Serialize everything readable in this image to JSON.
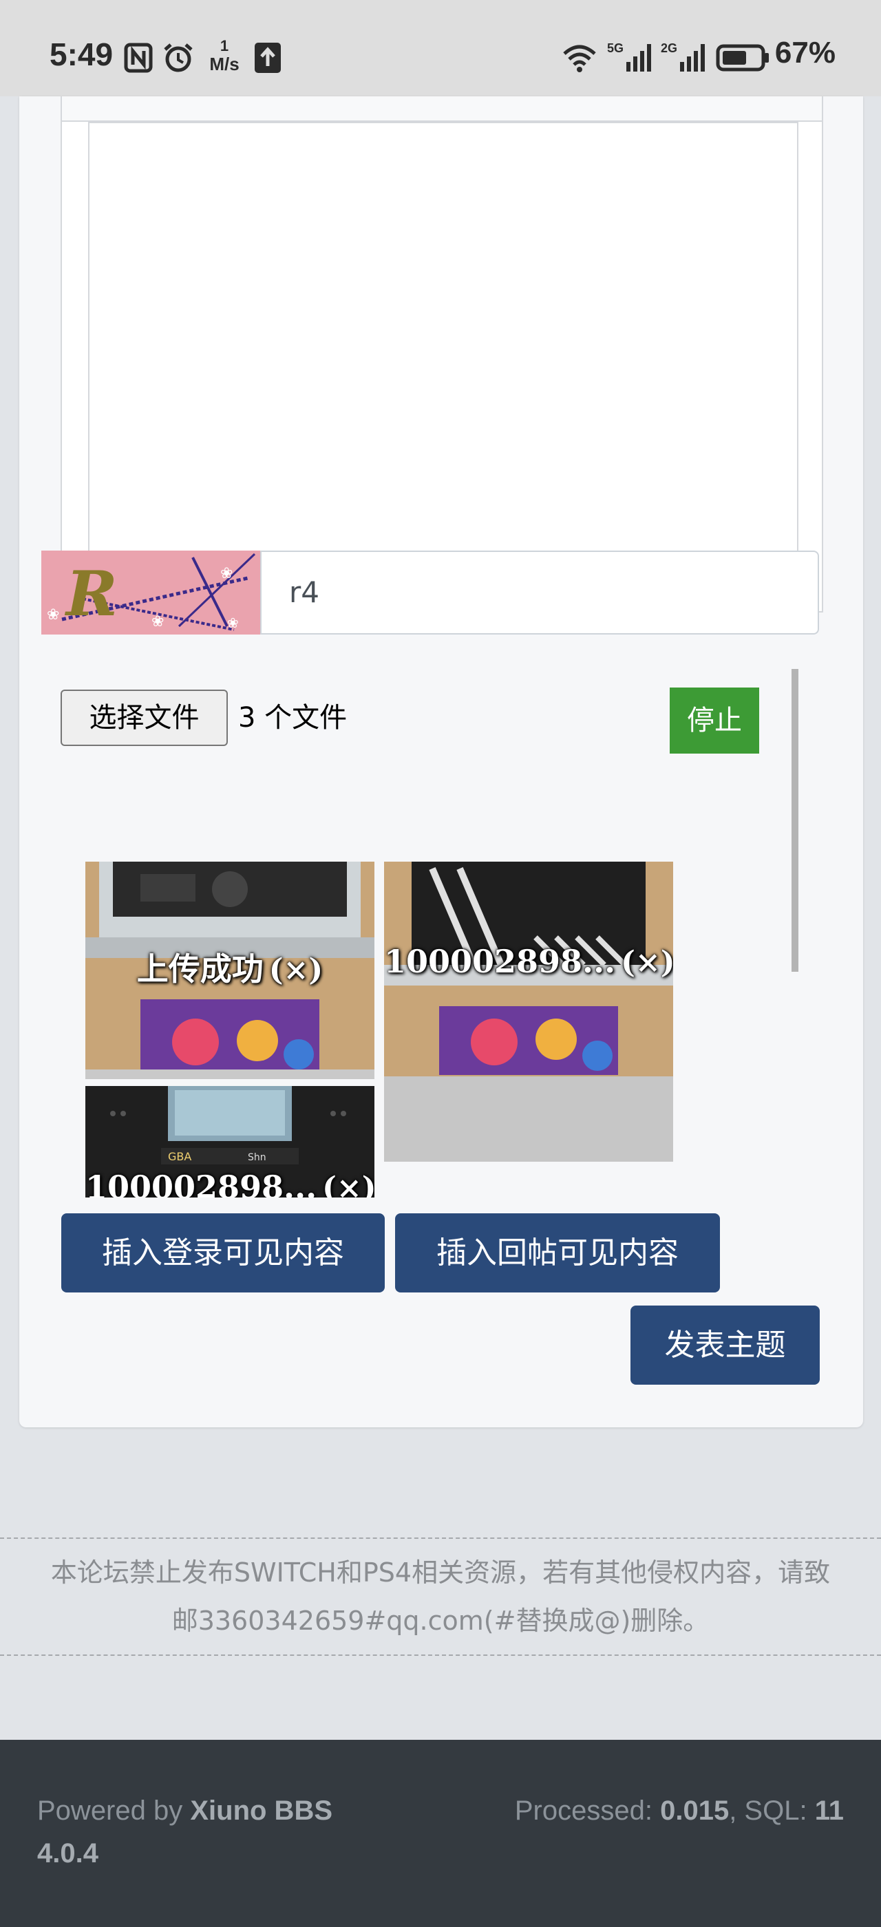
{
  "status_bar": {
    "time": "5:49",
    "speed_value": "1",
    "speed_unit": "M/s",
    "battery": "67%",
    "icons": [
      "nfc-icon",
      "alarm-icon",
      "upload-icon",
      "wifi-icon",
      "signal-5g-icon",
      "signal-2g-icon",
      "battery-icon"
    ]
  },
  "captcha": {
    "image_text": "R A",
    "input_value": "r4"
  },
  "upload": {
    "choose_file_label": "选择文件",
    "file_count": "3 个文件",
    "stop_label": "停止",
    "files": [
      {
        "label": "上传成功",
        "close": "(×)"
      },
      {
        "label": "100002898...",
        "close": "(×)"
      },
      {
        "label": "100002898...",
        "close": "(×)"
      }
    ]
  },
  "actions": {
    "insert_login_visible": "插入登录可见内容",
    "insert_reply_visible": "插入回帖可见内容",
    "publish": "发表主题"
  },
  "notice": {
    "line1": "本论坛禁止发布SWITCH和PS4相关资源，若有其他侵权内容，请致",
    "line2": "邮3360342659#qq.com(#替换成@)删除。"
  },
  "footer": {
    "powered_prefix": "Powered by ",
    "powered_name": "Xiuno BBS",
    "version": "4.0.4",
    "processed_label": "Processed: ",
    "processed_value": "0.015",
    "sql_label": ", SQL: ",
    "sql_value": "11"
  }
}
